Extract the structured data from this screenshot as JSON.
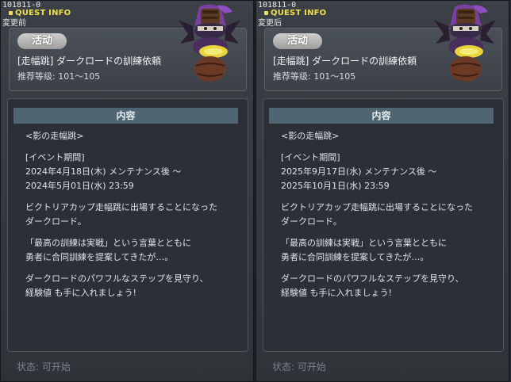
{
  "panels": [
    {
      "quest_id": "101811-0",
      "quest_info_label": "QUEST INFO",
      "phase_label": "変更前",
      "badge": "活动",
      "title": "[走幅跳] ダークロードの訓練依頼",
      "level": "推荐等级:  101～105",
      "content_header": "内容",
      "lines": [
        "<影の走幅跳>",
        "",
        "[イベント期間]",
        "2024年4月18日(木) メンテナンス後 ～",
        "2024年5月01日(水) 23:59",
        "",
        "ビクトリアカップ走幅跳に出場することになった",
        "ダークロード。",
        "",
        "「最高の訓練は実戦」という言葉とともに",
        "勇者に合同訓練を提案してきたが…。",
        "",
        "ダークロードのパワフルなステップを見守り、",
        "経験値 も手に入れましょう!"
      ],
      "status": "状态:  可开始"
    },
    {
      "quest_id": "101811-0",
      "quest_info_label": "QUEST INFO",
      "phase_label": "変更后",
      "badge": "活动",
      "title": "[走幅跳] ダークロードの訓練依頼",
      "level": "推荐等级:  101～105",
      "content_header": "内容",
      "lines": [
        "<影の走幅跳>",
        "",
        "[イベント期間]",
        "2025年9月17日(水) メンテナンス後 ～",
        "2025年10月1日(水) 23:59",
        "",
        "ビクトリアカップ走幅跳に出場することになった",
        "ダークロード。",
        "",
        "「最高の訓練は実戦」という言葉とともに",
        "勇者に合同訓練を提案してきたが…。",
        "",
        "ダークロードのパワフルなステップを見守り、",
        "経験値 も手に入れましょう!"
      ],
      "status": "状态:  可开始"
    }
  ],
  "npc_icon": "dark-lord-npc-icon",
  "colors": {
    "quest_info": "#f0e04a",
    "content_header": "#4f6672",
    "badge": "#b5b5b5"
  }
}
